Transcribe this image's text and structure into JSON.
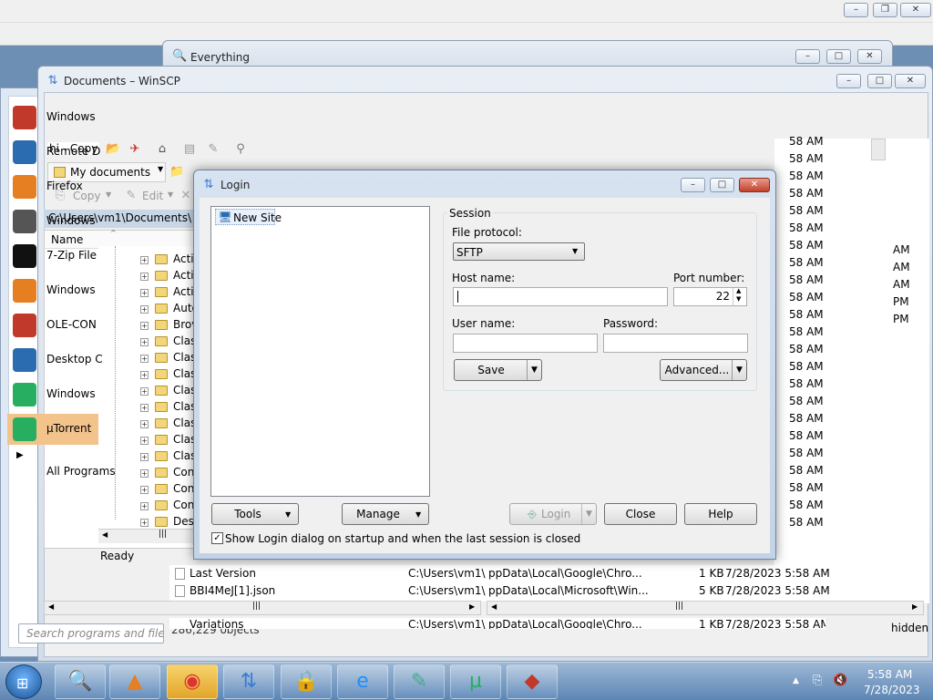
{
  "everything": {
    "title": "Everything"
  },
  "winscp": {
    "title": "Documents – WinSCP",
    "left": {
      "session_label": "hi - Copy",
      "location": "My documents",
      "copy_label": "Copy",
      "edit_label": "Edit",
      "path": "C:\\Users\\vm1\\Documents\\",
      "col_name": "Name",
      "status": "Ready",
      "tree": [
        "Acti",
        "Acti",
        "Acti",
        "Auto",
        "Brov",
        "Clas",
        "Clas",
        "Clas",
        "Clas",
        "Clas",
        "Clas",
        "Clas",
        "Clas",
        "Con",
        "Con",
        "Con",
        "Desl"
      ]
    },
    "right": {
      "times": [
        "58 AM",
        "58 AM",
        "58 AM",
        "58 AM",
        "58 AM",
        "58 AM",
        "58 AM",
        "58 AM",
        "58 AM",
        "58 AM",
        "58 AM",
        "58 AM",
        "58 AM",
        "58 AM",
        "58 AM",
        "58 AM",
        "58 AM",
        "58 AM",
        "58 AM",
        "58 AM",
        "58 AM",
        "58 AM",
        "58 AM"
      ],
      "extra": [
        "AM",
        "AM",
        "AM",
        "PM",
        "PM"
      ],
      "rows": [
        {
          "name": "Last Version",
          "path": "C:\\Users\\vm1\\",
          "mid": "ppData\\Local\\Google\\Chro...",
          "size": "1 KB",
          "date": "7/28/2023 5:58 AM"
        },
        {
          "name": "BBI4MeJ[1].json",
          "path": "C:\\Users\\vm1\\",
          "mid": "ppData\\Local\\Microsoft\\Win...",
          "size": "5 KB",
          "date": "7/28/2023 5:58 AM"
        },
        {
          "name": "Variations",
          "path": "C:\\Users\\vm1\\",
          "mid": "ppData\\Local\\Google\\Chro...",
          "size": "1 KB",
          "date": "7/28/2023 5:58 AM"
        }
      ],
      "hidden_label": "hidden",
      "count_label": "286,229 objects"
    }
  },
  "start_menu": {
    "items": [
      "Windows",
      "Remote D",
      "Firefox",
      "Windows",
      "7-Zip File",
      "Windows",
      "OLE-CON",
      "Desktop C",
      "Windows",
      "µTorrent",
      "All Programs"
    ],
    "search_placeholder": "Search programs and files"
  },
  "login": {
    "title": "Login",
    "site_new": "New Site",
    "session_group": "Session",
    "file_protocol_label": "File protocol:",
    "file_protocol_value": "SFTP",
    "host_label": "Host name:",
    "host_value": "",
    "port_label": "Port number:",
    "port_value": "22",
    "user_label": "User name:",
    "password_label": "Password:",
    "save_label": "Save",
    "advanced_label": "Advanced...",
    "tools_label": "Tools",
    "manage_label": "Manage",
    "login_label": "Login",
    "close_label": "Close",
    "help_label": "Help",
    "show_login_checkbox": "Show Login dialog on startup and when the last session is closed"
  },
  "taskbar": {
    "time": "5:58 AM",
    "date": "7/28/2023",
    "apps": [
      "search-app-icon",
      "vlc-icon",
      "chrome-icon",
      "winscp-icon",
      "keepass-icon",
      "ie-icon",
      "notepad-icon",
      "utorrent-icon",
      "ole-icon"
    ]
  }
}
